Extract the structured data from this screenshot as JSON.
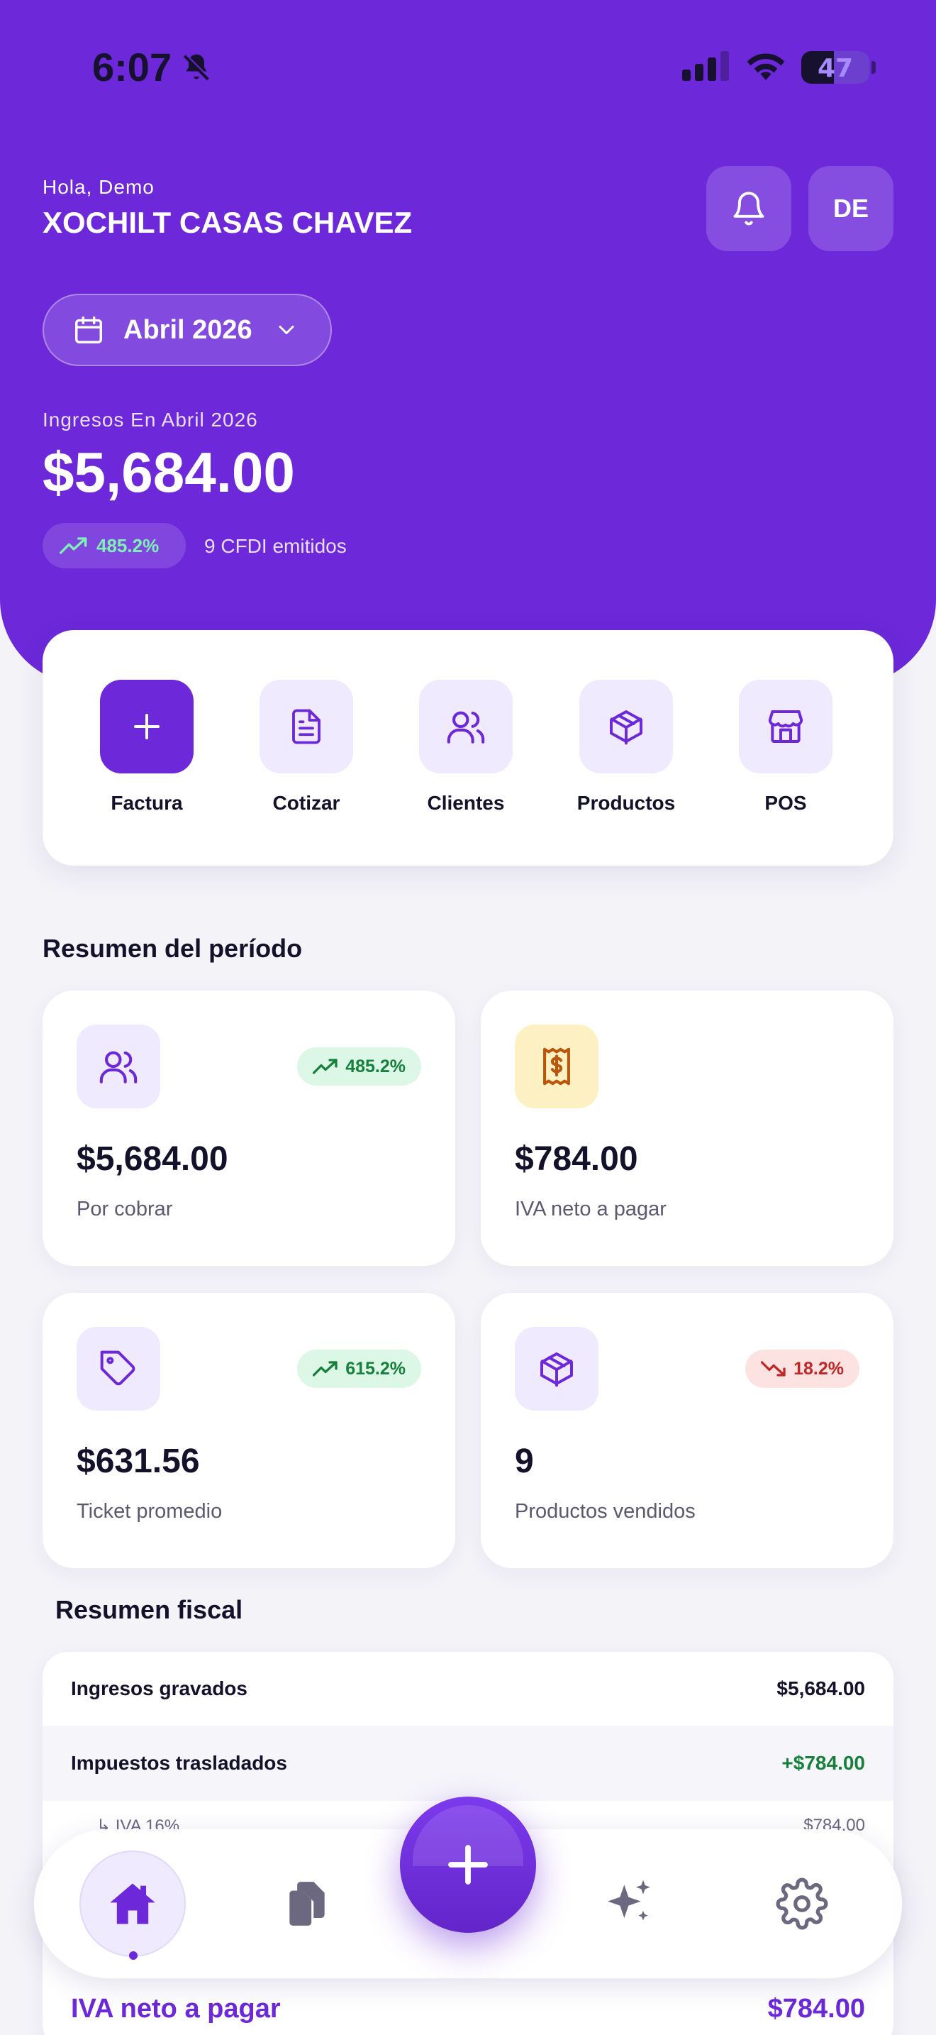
{
  "status_bar": {
    "time": "6:07",
    "battery": "47"
  },
  "header": {
    "greeting": "Hola, Demo",
    "user_name": "XOCHILT CASAS CHAVEZ",
    "avatar_initials": "DE"
  },
  "period": {
    "label": "Abril 2026"
  },
  "income": {
    "label": "Ingresos En Abril 2026",
    "amount": "$5,684.00",
    "growth": "485.2%",
    "cfdi_count": "9 CFDI emitidos"
  },
  "quick_actions": [
    {
      "label": "Factura",
      "icon": "plus-icon"
    },
    {
      "label": "Cotizar",
      "icon": "document-icon"
    },
    {
      "label": "Clientes",
      "icon": "users-icon"
    },
    {
      "label": "Productos",
      "icon": "box-icon"
    },
    {
      "label": "POS",
      "icon": "store-icon"
    }
  ],
  "summary": {
    "title": "Resumen del período",
    "cards": [
      {
        "value": "$5,684.00",
        "caption": "Por cobrar",
        "trend": "485.2%",
        "trend_dir": "up",
        "icon": "users-icon"
      },
      {
        "value": "$784.00",
        "caption": "IVA neto a pagar",
        "icon": "receipt-icon"
      },
      {
        "value": "$631.56",
        "caption": "Ticket promedio",
        "trend": "615.2%",
        "trend_dir": "up",
        "icon": "tag-icon"
      },
      {
        "value": "9",
        "caption": "Productos vendidos",
        "trend": "18.2%",
        "trend_dir": "down",
        "icon": "box-icon"
      }
    ]
  },
  "fiscal": {
    "title": "Resumen fiscal",
    "rows": [
      {
        "label": "Ingresos gravados",
        "value": "$5,684.00"
      },
      {
        "label": "Impuestos trasladados",
        "value": "+$784.00"
      },
      {
        "label": "↳ IVA 16%",
        "value": "$784.00"
      },
      {
        "label": "IVA neto a pagar",
        "value": "$784.00"
      }
    ]
  },
  "nav": {
    "items": [
      "home-icon",
      "documents-icon",
      "sparkles-icon",
      "gear-icon"
    ],
    "fab_icon": "plus-icon"
  },
  "colors": {
    "brand": "#6c28d9",
    "positive": "#17803d",
    "negative": "#c02626",
    "amber": "#b8570c"
  }
}
